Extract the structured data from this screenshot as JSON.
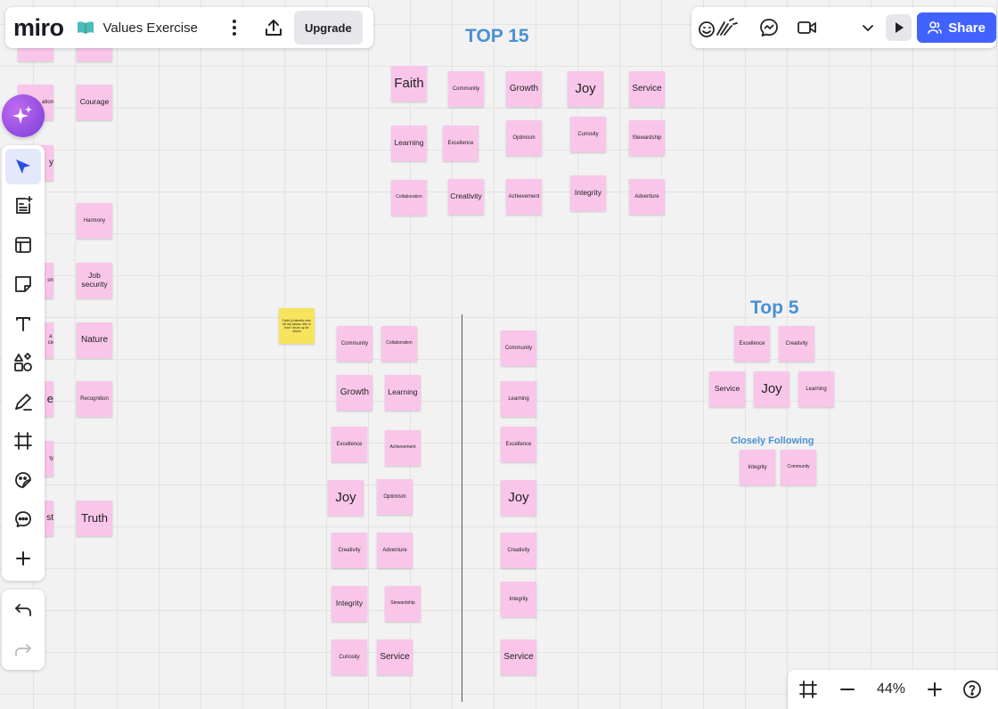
{
  "app": {
    "logo": "miro",
    "board_title": "Values Exercise",
    "upgrade_label": "Upgrade",
    "share_label": "Share",
    "zoom_level": "44%",
    "accent_color": "#4262ff"
  },
  "headings": {
    "top15": "TOP 15",
    "top5": "Top 5",
    "closely_following": "Closely Following"
  },
  "notes": {
    "left_col_a": [
      "",
      "ation",
      "y",
      "on",
      "a\nce",
      "e",
      "ty",
      "st"
    ],
    "left_col_b": [
      "",
      "Courage",
      "Harmony",
      "Job security",
      "Nature",
      "Recognition",
      "Truth"
    ],
    "top15": [
      "Faith",
      "Community",
      "Growth",
      "Joy",
      "Service",
      "Learning",
      "Excellence",
      "Optimism",
      "Curiosity",
      "Stewardship",
      "Collaboration",
      "Creativity",
      "Achievement",
      "Integrity",
      "Adventure"
    ],
    "yellow_note": "Faith (Umbrella over all my values- lets in how I show up for others",
    "mid_left": [
      "Community",
      "Growth",
      "Excellence",
      "Joy",
      "Creativity",
      "Integrity",
      "Curiosity"
    ],
    "mid_right": [
      "Collaboration",
      "Learning",
      "Achievement",
      "Optimism",
      "Adventure",
      "Stewardship",
      "Service"
    ],
    "right_col": [
      "Community",
      "Learning",
      "Excellence",
      "Joy",
      "Creativity",
      "Integrity",
      "Service"
    ],
    "top5": [
      "Excellence",
      "Creativity",
      "Service",
      "Joy",
      "Learning"
    ],
    "closely": [
      "Integrity",
      "Community"
    ]
  }
}
